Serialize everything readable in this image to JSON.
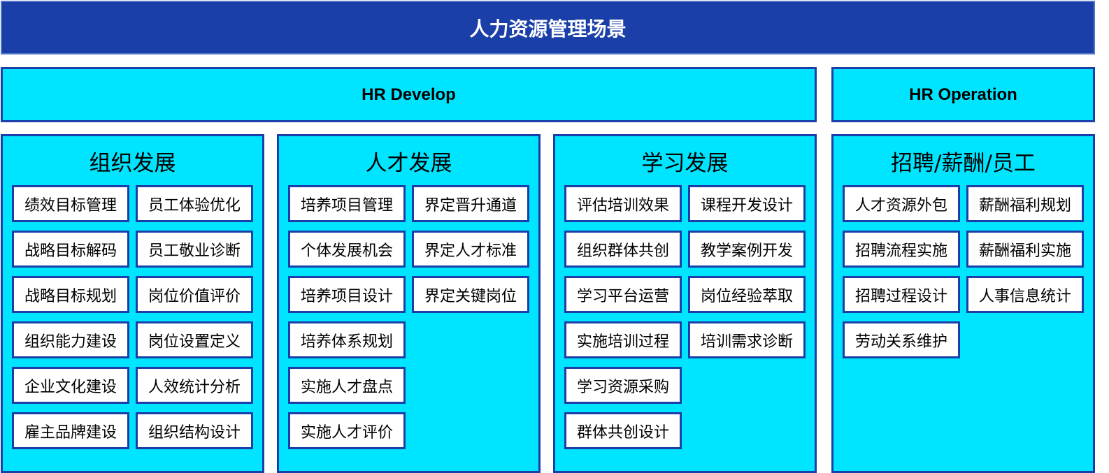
{
  "title": "人力资源管理场景",
  "banners": {
    "develop": "HR Develop",
    "operation": "HR Operation"
  },
  "panels": [
    {
      "title": "组织发展",
      "items": [
        "绩效目标管理",
        "员工体验优化",
        "战略目标解码",
        "员工敬业诊断",
        "战略目标规划",
        "岗位价值评价",
        "组织能力建设",
        "岗位设置定义",
        "企业文化建设",
        "人效统计分析",
        "雇主品牌建设",
        "组织结构设计"
      ]
    },
    {
      "title": "人才发展",
      "items": [
        "培养项目管理",
        "界定晋升通道",
        "个体发展机会",
        "界定人才标准",
        "培养项目设计",
        "界定关键岗位",
        "培养体系规划",
        "实施人才盘点",
        "实施人才评价"
      ]
    },
    {
      "title": "学习发展",
      "items": [
        "评估培训效果",
        "课程开发设计",
        "组织群体共创",
        "教学案例开发",
        "学习平台运营",
        "岗位经验萃取",
        "实施培训过程",
        "培训需求诊断",
        "学习资源采购",
        "群体共创设计"
      ]
    },
    {
      "title": "招聘/薪酬/员工",
      "items": [
        "人才资源外包",
        "薪酬福利规划",
        "招聘流程实施",
        "薪酬福利实施",
        "招聘过程设计",
        "人事信息统计",
        "劳动关系维护"
      ]
    }
  ]
}
